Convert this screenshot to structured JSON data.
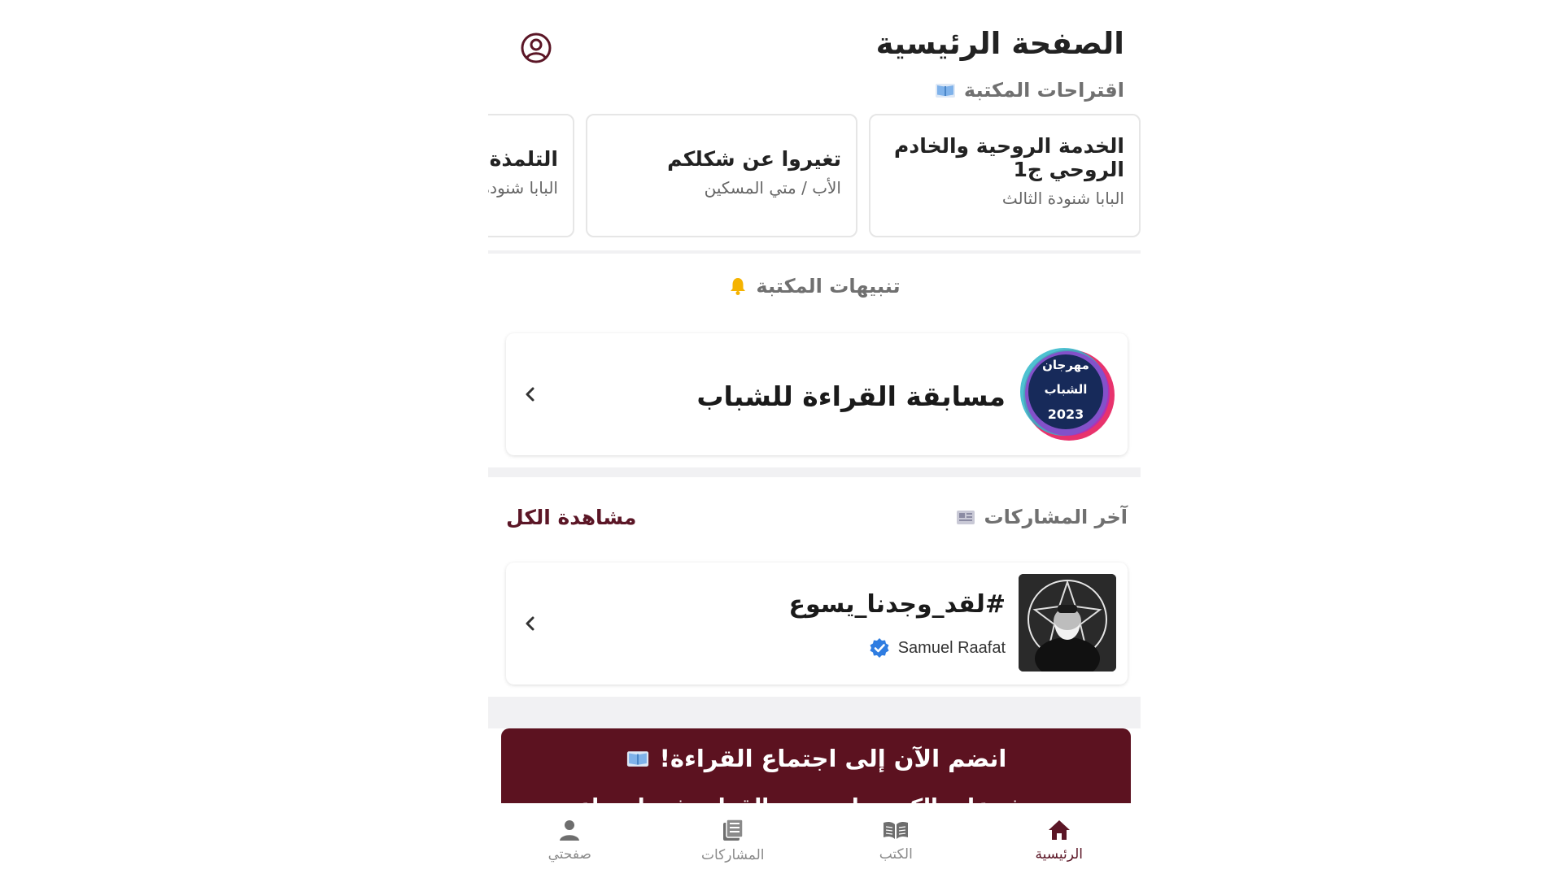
{
  "header": {
    "title": "الصفحة الرئيسية",
    "profile_icon": "user-circle-icon"
  },
  "suggestions": {
    "label": "اقتراحات المكتبة",
    "icon": "open-book-icon",
    "items": [
      {
        "title": "الخدمة الروحية والخادم الروحي ج1",
        "author": "البابا شنودة الثالث"
      },
      {
        "title": "تغيروا عن شكلكم",
        "author": "الأب / متي المسكين"
      },
      {
        "title": "التلمذة",
        "author": "البابا شنودة الثالث"
      }
    ]
  },
  "alerts": {
    "label": "تنبيهات المكتبة",
    "icon": "bell-icon",
    "item": {
      "title": "مسابقة القراءة للشباب",
      "badge_lines": [
        "مهرجان",
        "الشباب",
        "2023"
      ]
    }
  },
  "posts": {
    "label": "آخر المشاركات",
    "icon": "newspaper-icon",
    "view_all": "مشاهدة الكل",
    "item": {
      "title": "#لقد_وجدنا_يسوع",
      "author": "Samuel Raafat",
      "verified": true
    }
  },
  "banner": {
    "title": "انضم الآن إلى اجتماع القراءة!",
    "subtitle": "تعرف على الكتب واستمتع بالقراءة في اجتماع"
  },
  "bottom_nav": [
    {
      "label": "الرئيسية",
      "icon": "home-icon",
      "active": true
    },
    {
      "label": "الكتب",
      "icon": "book-icon",
      "active": false
    },
    {
      "label": "المشاركات",
      "icon": "posts-icon",
      "active": false
    },
    {
      "label": "صفحتي",
      "icon": "person-icon",
      "active": false
    }
  ],
  "colors": {
    "accent": "#5b1626",
    "banner_bg": "#5c1220",
    "alert_bell": "#f5b300",
    "verified_badge": "#2f7de1"
  }
}
